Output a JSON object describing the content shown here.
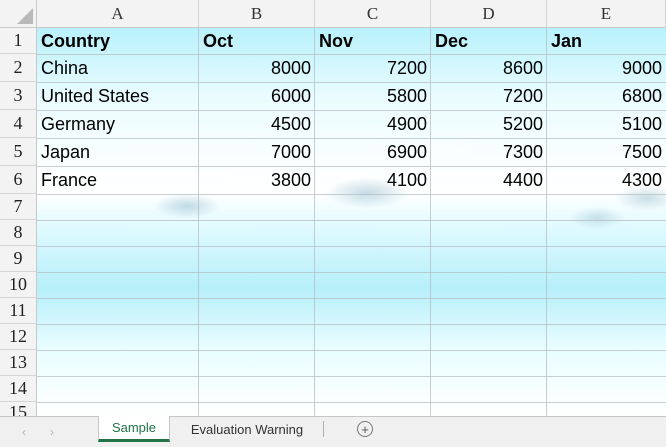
{
  "columns": [
    "A",
    "B",
    "C",
    "D",
    "E"
  ],
  "rows": [
    "1",
    "2",
    "3",
    "4",
    "5",
    "6",
    "7",
    "8",
    "9",
    "10",
    "11",
    "12",
    "13",
    "14",
    "15"
  ],
  "table": {
    "header": [
      "Country",
      "Oct",
      "Nov",
      "Dec",
      "Jan"
    ],
    "data": [
      [
        "China",
        "8000",
        "7200",
        "8600",
        "9000"
      ],
      [
        "United States",
        "6000",
        "5800",
        "7200",
        "6800"
      ],
      [
        "Germany",
        "4500",
        "4900",
        "5200",
        "5100"
      ],
      [
        "Japan",
        "7000",
        "6900",
        "7300",
        "7500"
      ],
      [
        "France",
        "3800",
        "4100",
        "4400",
        "4300"
      ]
    ]
  },
  "tabs": {
    "sheets": [
      "Sample",
      "Evaluation Warning"
    ],
    "active": "Sample",
    "prev_icon": "‹",
    "next_icon": "›",
    "add_icon": "+"
  },
  "colors": {
    "active_tab": "#217346",
    "sky": "#b8f1fb"
  }
}
